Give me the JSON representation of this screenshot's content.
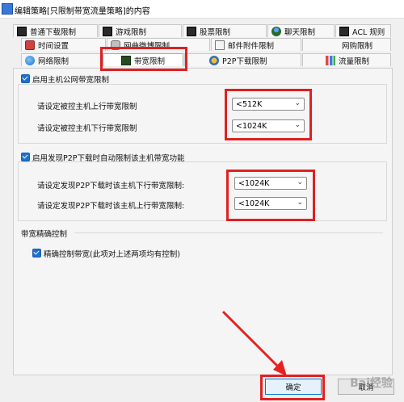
{
  "window": {
    "title": "编辑策略[只限制带宽流量策略]的内容"
  },
  "tabs": {
    "row1": [
      {
        "label": "普通下载限制",
        "icon": "download-icon"
      },
      {
        "label": "游戏限制",
        "icon": "game-icon"
      },
      {
        "label": "股票限制",
        "icon": "stock-icon"
      },
      {
        "label": "聊天限制",
        "icon": "chat-icon"
      },
      {
        "label": "ACL 规则",
        "icon": "acl-icon"
      }
    ],
    "row2": [
      {
        "label": "时间设置",
        "icon": "clock-icon"
      },
      {
        "label": "网曲微博限制",
        "icon": "blog-icon"
      },
      {
        "label": "邮件附件限制",
        "icon": "mail-icon"
      },
      {
        "label": "网购限制",
        "icon": "shopping-icon"
      }
    ],
    "row3": [
      {
        "label": "网络限制",
        "icon": "globe-icon"
      },
      {
        "label": "带宽限制",
        "icon": "bandwidth-icon",
        "active": true
      },
      {
        "label": "P2P下载限制",
        "icon": "p2p-icon"
      },
      {
        "label": "流量限制",
        "icon": "traffic-icon"
      }
    ]
  },
  "bandwidth": {
    "enable_public_label": "启用主机公网带宽限制",
    "upload_label": "请设定被控主机上行带宽限制",
    "upload_value": "<512K",
    "download_label": "请设定被控主机下行带宽限制",
    "download_value": "<1024K",
    "enable_p2p_label": "启用发现P2P下载时自动限制该主机带宽功能",
    "p2p_download_label": "请设定发现P2P下载时该主机下行带宽限制:",
    "p2p_download_value": "<1024K",
    "p2p_upload_label": "请设定发现P2P下载时该主机上行带宽限制:",
    "p2p_upload_value": "<1024K",
    "precise_group_label": "带宽精确控制",
    "precise_check_label": "精确控制带宽(此项对上述两项均有控制)"
  },
  "buttons": {
    "ok": "确定",
    "cancel": "取消"
  },
  "watermark": "Bai经验",
  "colors": {
    "highlight": "#e02020",
    "checkbox": "#1f6fd1"
  }
}
